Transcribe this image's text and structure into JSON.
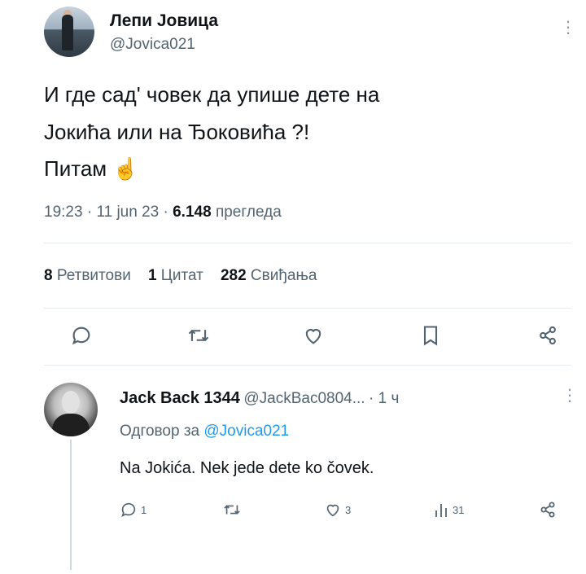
{
  "tweet": {
    "author_name": "Лепи Јовица",
    "author_handle": "@Jovica021",
    "text_line1": "И где сад' човек да упише дете на",
    "text_line2": "Јокића или на Ђоковића ?!",
    "text_line3": "Питам",
    "emoji": "☝️",
    "time": "19:23",
    "date": "11 jun 23",
    "views_count": "6.148",
    "views_label": "прегледа",
    "retweets_count": "8",
    "retweets_label": "Ретвитови",
    "quotes_count": "1",
    "quotes_label": "Цитат",
    "likes_count": "282",
    "likes_label": "Свиђања"
  },
  "reply": {
    "author_name": "Jack Back 1344",
    "author_handle": "@JackBac0804...",
    "time": "· 1 ч",
    "replying_prefix": "Одговор за",
    "replying_to": "@Jovica021",
    "text": "Na Jokića. Nek jede dete ko čovek.",
    "reply_count": "1",
    "like_count": "3",
    "views_count": "31"
  },
  "icons": {
    "reply": "reply-icon",
    "retweet": "retweet-icon",
    "like": "heart-icon",
    "bookmark": "bookmark-icon",
    "share": "share-icon",
    "views": "views-icon",
    "more": "more-icon"
  }
}
